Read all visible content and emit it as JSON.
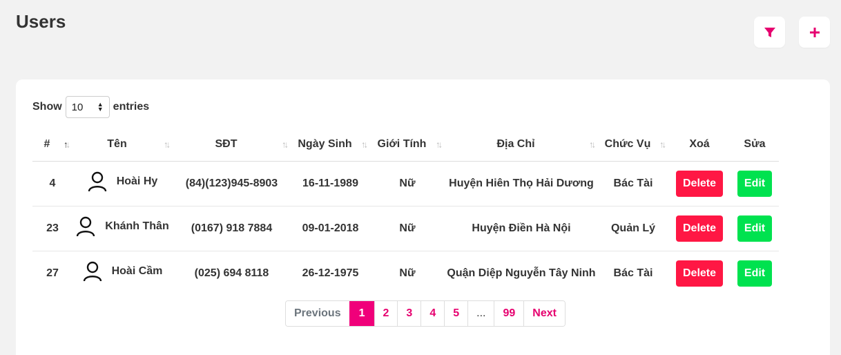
{
  "page": {
    "title": "Users"
  },
  "header": {
    "filter_icon": "filter-icon",
    "add_icon": "plus-icon",
    "accent": "#e6006f"
  },
  "entries": {
    "show_label": "Show",
    "value": "10",
    "entries_label": "entries"
  },
  "table": {
    "columns": [
      "#",
      "Tên",
      "SĐT",
      "Ngày Sinh",
      "Giới Tính",
      "Địa Chỉ",
      "Chức Vụ",
      "Xoá",
      "Sửa"
    ],
    "rows": [
      {
        "id": "4",
        "name": "Hoài Hy",
        "phone": "(84)(123)945-8903",
        "dob": "16-11-1989",
        "gender": "Nữ",
        "address": "Huyện Hiên Thọ Hải Dương",
        "role": "Bác Tài",
        "delete": "Delete",
        "edit": "Edit"
      },
      {
        "id": "23",
        "name": "Khánh Thân",
        "phone": "(0167) 918 7884",
        "dob": "09-01-2018",
        "gender": "Nữ",
        "address": "Huyện Điền Hà Nội",
        "role": "Quản Lý",
        "delete": "Delete",
        "edit": "Edit"
      },
      {
        "id": "27",
        "name": "Hoài Cầm",
        "phone": "(025) 694 8118",
        "dob": "26-12-1975",
        "gender": "Nữ",
        "address": "Quận Diệp Nguyễn Tây Ninh",
        "role": "Bác Tài",
        "delete": "Delete",
        "edit": "Edit"
      }
    ],
    "colors": {
      "delete": "#ff1744",
      "edit": "#00e24f"
    }
  },
  "pagination": {
    "previous": "Previous",
    "pages": [
      "1",
      "2",
      "3",
      "4",
      "5"
    ],
    "dots": "...",
    "last": "99",
    "next": "Next",
    "active": "1"
  }
}
